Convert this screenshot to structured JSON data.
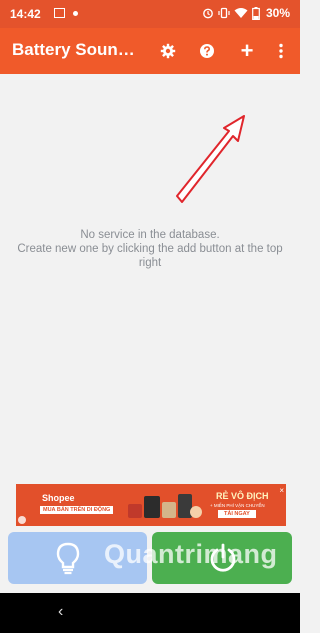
{
  "status_bar": {
    "time": "14:42",
    "battery": "30%"
  },
  "app_bar": {
    "title": "Battery Sound Notification",
    "add_glyph": "+"
  },
  "main": {
    "empty_line1": "No service in the database.",
    "empty_line2": "Create new one by clicking the add button at the top right"
  },
  "ad": {
    "brand": "Shopee",
    "tagline": "MUA BÁN TRÊN DI ĐỘNG",
    "headline": "RẺ VÔ ĐỊCH",
    "subline": "+ MIỄN PHÍ VẬN CHUYỂN",
    "cta": "TẢI NGAY",
    "close_glyph": "×"
  },
  "watermark": "Quantrimang",
  "nav": {
    "back_glyph": "‹"
  },
  "colors": {
    "status_bar": "#e4532c",
    "app_bar": "#f05a2a",
    "left_button": "#a7c6f2",
    "right_button": "#4caf50"
  },
  "icons": [
    "image-icon",
    "notification-dot-icon",
    "alarm-icon",
    "vibrate-icon",
    "wifi-icon",
    "battery-icon",
    "settings-icon",
    "help-icon",
    "add-icon",
    "more-vert-icon",
    "lightbulb-icon",
    "power-icon",
    "back-icon"
  ]
}
